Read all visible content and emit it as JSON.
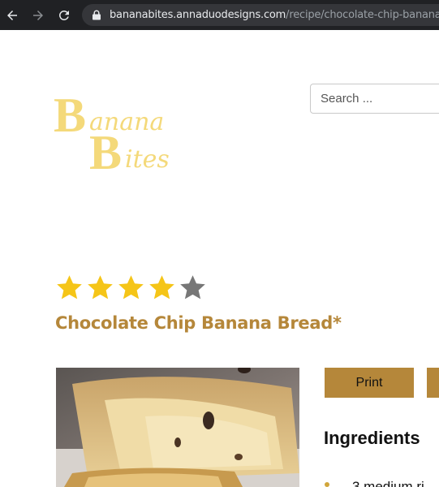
{
  "browser": {
    "url_host": "bananabites.annaduodesigns.com",
    "url_path": "/recipe/chocolate-chip-banana-"
  },
  "site": {
    "logo_text": "Banana Bites",
    "logo_color": "#f4d97a"
  },
  "search": {
    "placeholder": "Search ..."
  },
  "recipe": {
    "rating": 4,
    "rating_max": 5,
    "title": "Chocolate Chip Banana Bread*",
    "title_color": "#b5873a",
    "print_label": "Print",
    "ingredients_heading": "Ingredients",
    "ingredients": [
      "3 medium ri"
    ]
  },
  "colors": {
    "star_filled": "#f5c518",
    "star_empty": "#777777",
    "button_bg": "#b5873a"
  }
}
